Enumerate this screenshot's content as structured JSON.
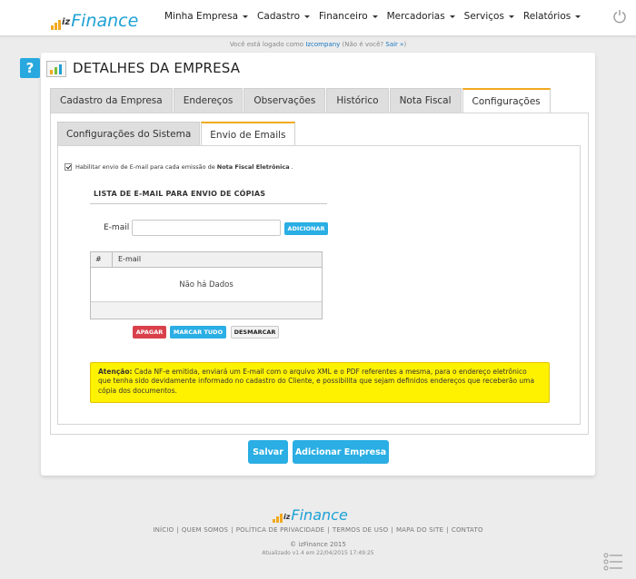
{
  "brand": {
    "prefix": "iz",
    "name": "Finance"
  },
  "nav": [
    "Minha Empresa",
    "Cadastro",
    "Financeiro",
    "Mercadorias",
    "Serviços",
    "Relatórios"
  ],
  "login": {
    "before": "Você está logado como ",
    "user": "Izcompany",
    "middle": " (Não é você? ",
    "logout": "Sair »",
    "after": ")"
  },
  "page": {
    "help": "?",
    "title": "DETALHES DA EMPRESA"
  },
  "tabs": [
    "Cadastro da Empresa",
    "Endereços",
    "Observações",
    "Histórico",
    "Nota Fiscal",
    "Configurações"
  ],
  "active_tab": "Configurações",
  "subtabs": [
    "Configurações do Sistema",
    "Envio de Emails"
  ],
  "active_subtab": "Envio de Emails",
  "settings": {
    "checkbox_text_a": "Habilitar envio de E-mail para cada emissão de",
    "checkbox_text_b": "Nota Fiscal Eletrônica",
    "checkbox_text_c": ".",
    "checked": true
  },
  "email_list": {
    "title": "LISTA DE E-MAIL PARA ENVIO DE CÓPIAS",
    "email_label": "E-mail",
    "email_value": "",
    "add_button": "ADICIONAR",
    "columns": [
      "#",
      "E-mail"
    ],
    "empty_text": "Não há Dados",
    "delete_button": "APAGAR",
    "mark_all_button": "MARCAR TUDO",
    "unmark_button": "DESMARCAR"
  },
  "alert": {
    "label": "Atenção:",
    "text": " Cada NF-e emitida, enviará um E-mail com o arquivo XML e o PDF referentes a mesma, para o endereço eletrônico que tenha sido devidamente informado no cadastro do Cliente, e possibilita que sejam definidos endereços que receberão uma cópia dos documentos."
  },
  "actions": {
    "save": "Salvar",
    "add_company": "Adicionar Empresa"
  },
  "footer": {
    "links": [
      "INÍCIO",
      "QUEM SOMOS",
      "POLÍTICA DE PRIVACIDADE",
      "TERMOS DE USO",
      "MAPA DO SITE",
      "CONTATO"
    ],
    "copyright": "© izFinance 2015",
    "updated": "Atualizado v1.4 em 22/04/2015 17:49:25"
  },
  "colors": {
    "accent": "#2aaee4",
    "brand_blue": "#1ca1d6",
    "brand_orange": "#f2a91f",
    "danger": "#d9414a",
    "alert_bg": "#fff200"
  },
  "icons": {
    "power": "power-icon",
    "menu": "menu-list-icon",
    "help": "help-icon",
    "title": "chart-report-icon"
  }
}
